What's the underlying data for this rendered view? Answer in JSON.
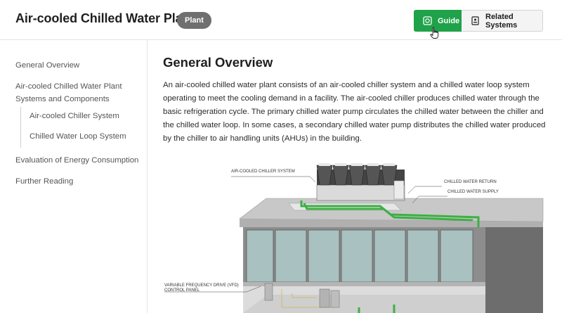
{
  "header": {
    "title": "Air-cooled Chilled Water Plant",
    "badge": "Plant",
    "guide_label": "Guide",
    "related_label": "Related Systems"
  },
  "sidebar": {
    "items": [
      {
        "label": "General Overview"
      },
      {
        "label": "Air-cooled Chilled Water Plant"
      },
      {
        "label": "Systems and Components"
      },
      {
        "label": "Air-cooled Chiller System"
      },
      {
        "label": "Chilled Water Loop System"
      },
      {
        "label": "Evaluation of Energy Consumption"
      },
      {
        "label": "Further Reading"
      }
    ]
  },
  "main": {
    "section_title": "General Overview",
    "paragraph": "An air-cooled chilled water plant consists of an air-cooled chiller system and a chilled water loop system operating to meet the cooling demand in a facility. The air-cooled chiller produces chilled water through the basic refrigeration cycle. The primary chilled water pump circulates the chilled water between the chiller and the chilled water loop. In some cases, a secondary chilled water pump distributes the chilled water produced by the chiller to air handling units (AHUs) in the building.",
    "diagram": {
      "label_chiller": "AIR-COOLED CHILLER SYSTEM",
      "label_return": "CHILLED WATER RETURN",
      "label_supply": "CHILLED WATER SUPPLY",
      "label_vfd_1": "VARIABLE FREQUENCY DRIVE (VFD)",
      "label_vfd_2": "CONTROL PANEL"
    }
  },
  "colors": {
    "accent_green": "#1fa24a",
    "badge_gray": "#6f6f6f",
    "pipe_green": "#3cb043"
  },
  "icons": {
    "guide": "guide-icon",
    "related": "related-systems-icon",
    "cursor": "hand-pointer-icon"
  }
}
